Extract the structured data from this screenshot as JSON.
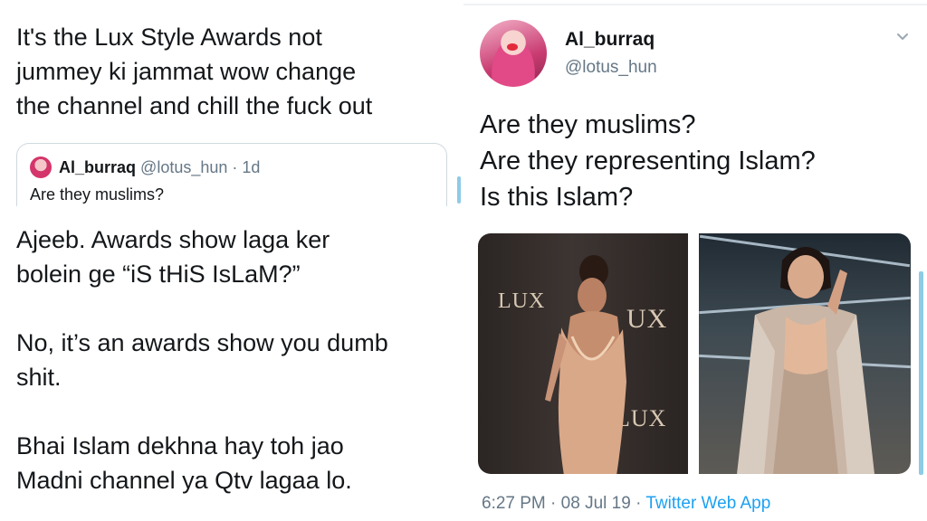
{
  "left_top": {
    "tweet_text": "It's the Lux Style Awards not\njummey ki jammat wow change\nthe channel and chill the fuck out",
    "quote": {
      "display_name": "Al_burraq",
      "handle": "@lotus_hun",
      "time": "1d",
      "text": "Are they muslims?"
    }
  },
  "left_bottom": {
    "tweet_text": "Ajeeb. Awards show laga ker\nbolein ge “iS tHiS IsLaM?”\n\nNo, it’s an awards show you dumb\nshit.\n\nBhai Islam dekhna hay toh jao\nMadni channel ya Qtv lagaa lo."
  },
  "right_tweet": {
    "display_name": "Al_burraq",
    "handle": "@lotus_hun",
    "tweet_text": "Are they muslims?\nAre they representing Islam?\nIs this Islam?",
    "media_left_logo": "LUX",
    "media_left_logo_2": "UX",
    "media_left_logo_3": "LUX",
    "time": "6:27 PM",
    "date": "08 Jul 19",
    "source": "Twitter Web App"
  },
  "icons": {
    "caret": "chevron-down-icon",
    "avatar": "avatar"
  },
  "colors": {
    "text": "#14171a",
    "secondary": "#657786",
    "link": "#1da1f2",
    "border": "#cfd9de"
  }
}
